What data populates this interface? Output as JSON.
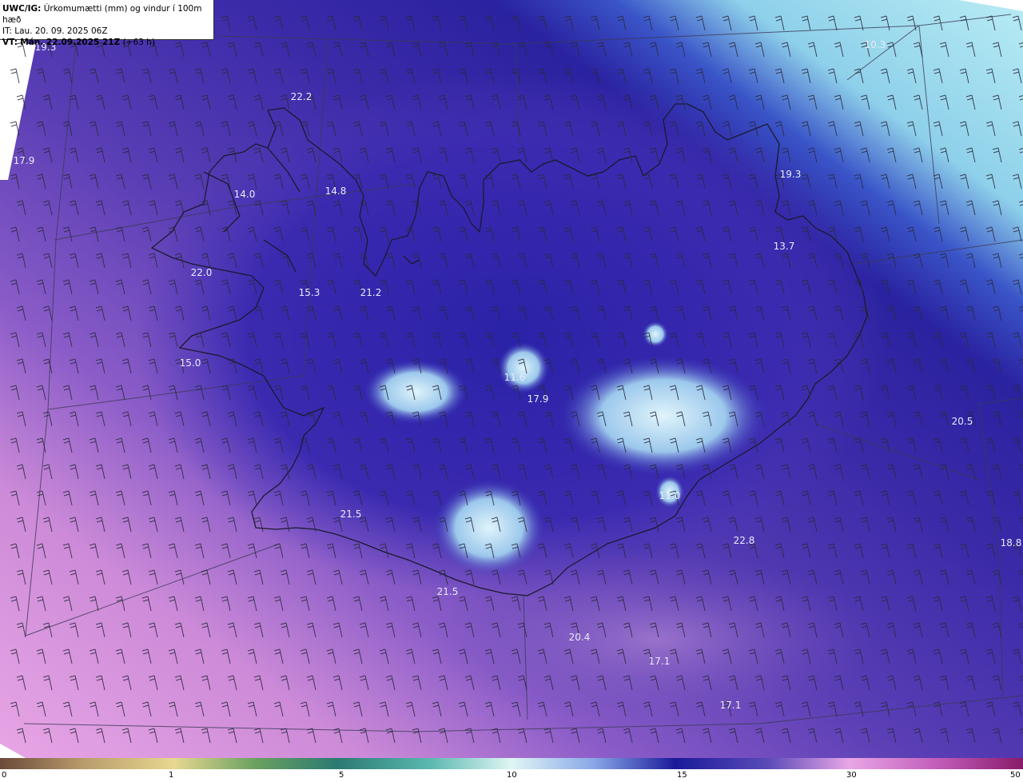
{
  "header": {
    "model": "UWC/IG:",
    "title": "Úrkomumætti (mm) og vindur í 100m hæð",
    "issue_time": "IT: Lau. 20. 09. 2025 06Z",
    "valid_prefix": "VT:",
    "valid_time": "Mán. 22.09.2025 21Z",
    "lead": "(+63 h)"
  },
  "colors": {
    "land_outline": "#1a1a2e",
    "grid_lines": "#3a3a55",
    "station_text": "#e8ecf8"
  },
  "colorbar": {
    "ticks": [
      "0",
      "1",
      "5",
      "10",
      "15",
      "30",
      "50"
    ]
  },
  "stations": [
    {
      "label": "19.3"
    },
    {
      "label": "22.2"
    },
    {
      "label": "17.9"
    },
    {
      "label": "14.0"
    },
    {
      "label": "14.8"
    },
    {
      "label": "22.0"
    },
    {
      "label": "15.3"
    },
    {
      "label": "21.2"
    },
    {
      "label": "15.0"
    },
    {
      "label": "11.6"
    },
    {
      "label": "17.9"
    },
    {
      "label": "19.3"
    },
    {
      "label": "13.7"
    },
    {
      "label": "20.5"
    },
    {
      "label": "11.0"
    },
    {
      "label": "22.8"
    },
    {
      "label": "18.8"
    },
    {
      "label": "21.5"
    },
    {
      "label": "21.5"
    },
    {
      "label": "20.4"
    },
    {
      "label": "17.1"
    },
    {
      "label": "17.1"
    },
    {
      "label": "10.3"
    }
  ]
}
